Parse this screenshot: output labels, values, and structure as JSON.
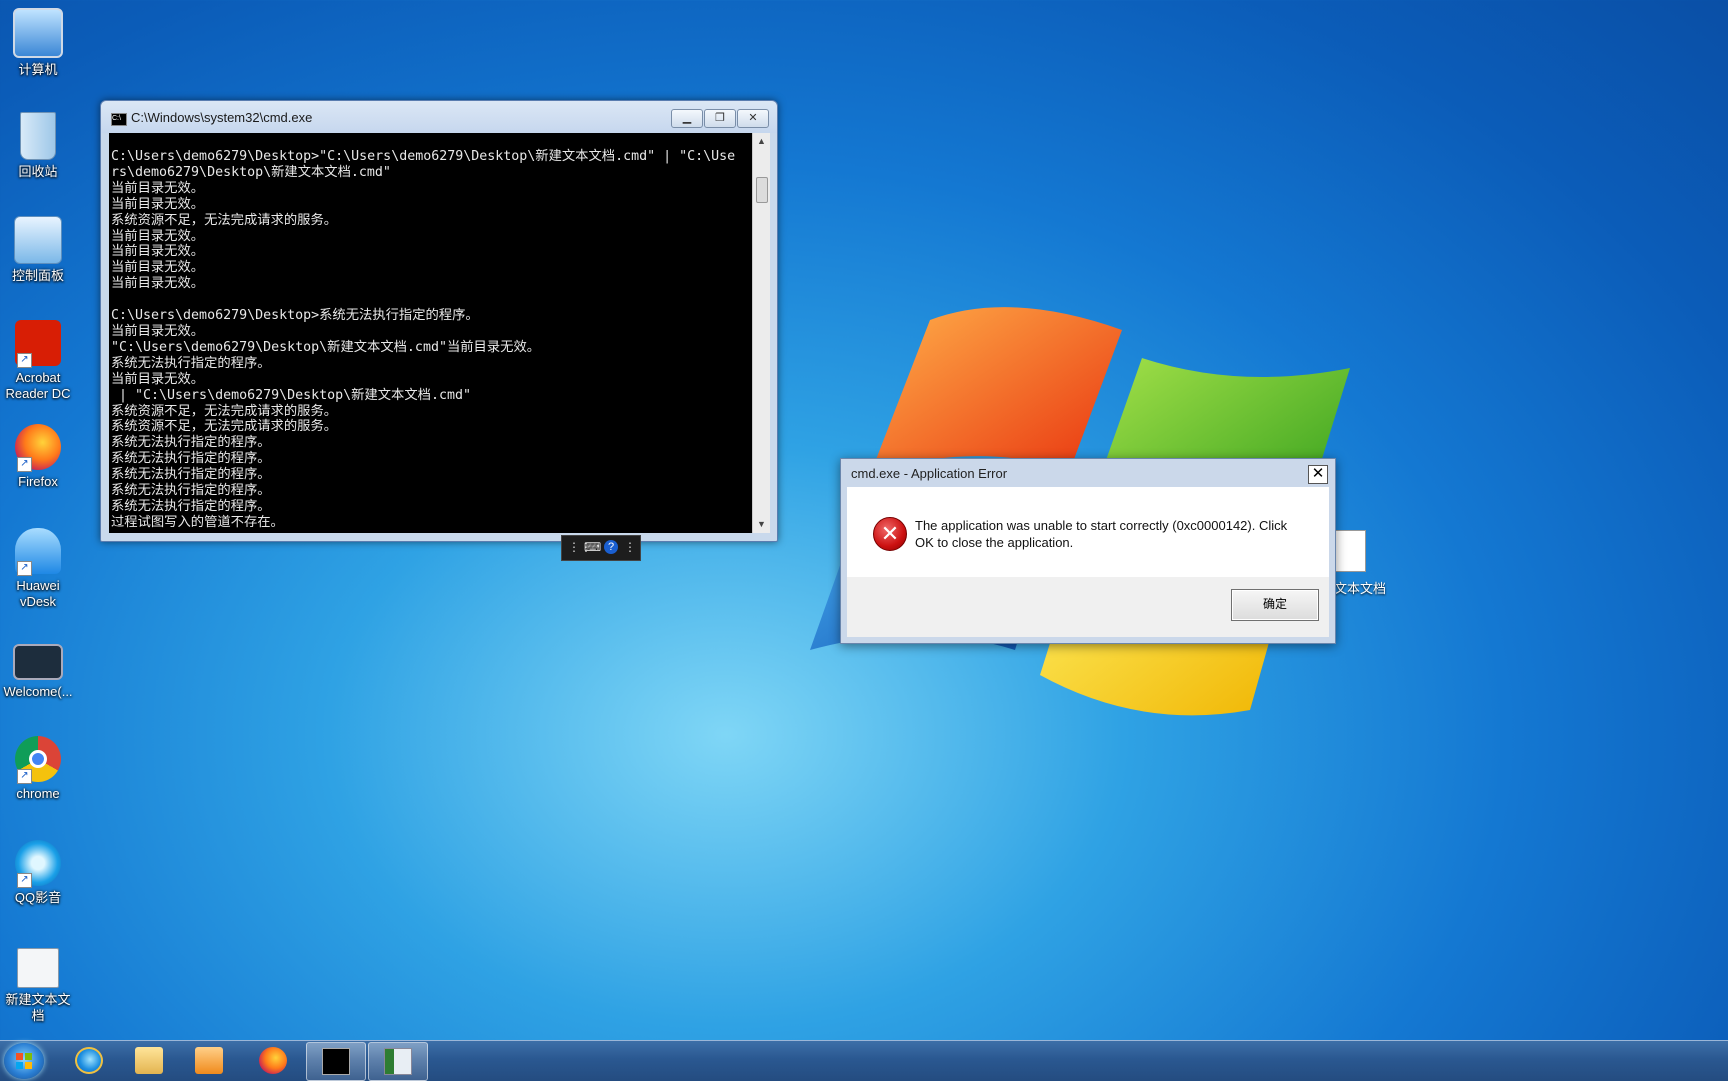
{
  "desktop": {
    "icons": [
      {
        "label": "计算机",
        "icon": "computer-icon",
        "shortcut": false
      },
      {
        "label": "回收站",
        "icon": "recycle-bin-icon",
        "shortcut": false
      },
      {
        "label": "控制面板",
        "icon": "control-panel-icon",
        "shortcut": false
      },
      {
        "label": "Acrobat Reader DC",
        "icon": "acrobat-icon",
        "shortcut": true
      },
      {
        "label": "Firefox",
        "icon": "firefox-icon",
        "shortcut": true
      },
      {
        "label": "Huawei vDesk",
        "icon": "huawei-vdesk-icon",
        "shortcut": true
      },
      {
        "label": "Welcome(...",
        "icon": "welcome-icon",
        "shortcut": false
      },
      {
        "label": "chrome",
        "icon": "chrome-icon",
        "shortcut": true
      },
      {
        "label": "QQ影音",
        "icon": "qq-player-icon",
        "shortcut": true
      },
      {
        "label": "新建文本文档",
        "icon": "settings-document-icon",
        "shortcut": false
      }
    ],
    "hidden_item_label": "文本文档"
  },
  "cmd_window": {
    "title": "C:\\Windows\\system32\\cmd.exe",
    "lines": [
      "C:\\Users\\demo6279\\Desktop>\"C:\\Users\\demo6279\\Desktop\\新建文本文档.cmd\" | \"C:\\Use",
      "rs\\demo6279\\Desktop\\新建文本文档.cmd\"",
      "当前目录无效。",
      "当前目录无效。",
      "系统资源不足，无法完成请求的服务。",
      "当前目录无效。",
      "当前目录无效。",
      "当前目录无效。",
      "当前目录无效。",
      "",
      "C:\\Users\\demo6279\\Desktop>系统无法执行指定的程序。",
      "当前目录无效。",
      "\"C:\\Users\\demo6279\\Desktop\\新建文本文档.cmd\"当前目录无效。",
      "系统无法执行指定的程序。",
      "当前目录无效。",
      " | \"C:\\Users\\demo6279\\Desktop\\新建文本文档.cmd\"",
      "系统资源不足，无法完成请求的服务。",
      "系统资源不足，无法完成请求的服务。",
      "系统无法执行指定的程序。",
      "系统无法执行指定的程序。",
      "系统无法执行指定的程序。",
      "系统无法执行指定的程序。",
      "系统无法执行指定的程序。",
      "过程试图写入的管道不存在。"
    ]
  },
  "error_dialog": {
    "title": "cmd.exe - Application Error",
    "message": "The application was unable to start correctly (0xc0000142). Click OK to close the application.",
    "ok_label": "确定",
    "close_glyph": "✕"
  },
  "taskbar": {
    "items": [
      "internet-explorer-icon",
      "file-explorer-icon",
      "media-player-icon",
      "firefox-icon",
      "cmd-icon",
      "window-app-icon"
    ],
    "active": [
      "cmd-icon",
      "window-app-icon"
    ]
  }
}
